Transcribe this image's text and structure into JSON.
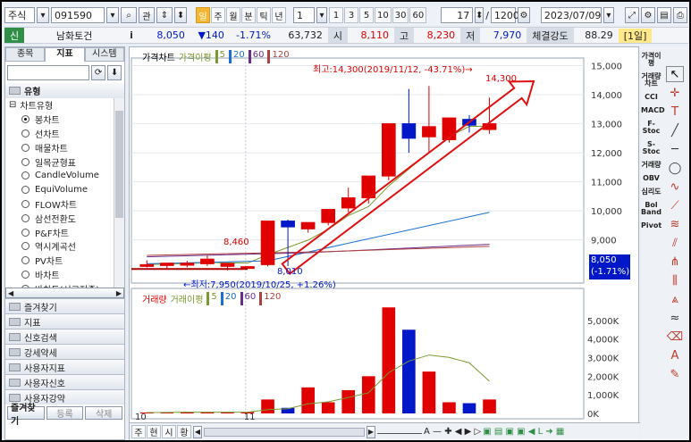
{
  "toolbar": {
    "market": "주식",
    "code": "091590",
    "btn_search": "⌕",
    "btn_gwan": "관",
    "periods": [
      "일",
      "주",
      "월",
      "분",
      "틱",
      "년"
    ],
    "active_period": "일",
    "interval_select": "1",
    "quick_intervals": [
      "1",
      "3",
      "5",
      "10",
      "30",
      "60"
    ],
    "count1": "17",
    "count2": "1200",
    "date": "2023/07/09"
  },
  "quote": {
    "badge": "신",
    "name": "남화토건",
    "info": "i",
    "price": "8,050",
    "change": "▼140",
    "pct": "-1.71%",
    "volume": "63,732",
    "open_lbl": "시",
    "open": "8,110",
    "high_lbl": "고",
    "high": "8,230",
    "low_lbl": "저",
    "low": "7,970",
    "strength_lbl": "체결강도",
    "strength": "88.29",
    "period_badge": "[1일]"
  },
  "left": {
    "tabs": [
      "종목",
      "지표",
      "시스템"
    ],
    "active_tab": "지표",
    "group_title": "유형",
    "subgroup": "차트유형",
    "items": [
      "봉차트",
      "선차트",
      "매물차트",
      "일목균형표",
      "CandleVolume",
      "EquiVolume",
      "FLOW차트",
      "삼선전환도",
      "P&F차트",
      "역시계곡선",
      "PV차트",
      "바차트",
      "바차트(시고저종)"
    ],
    "selected": "봉차트",
    "folders": [
      "즐겨찾기",
      "지표",
      "신호검색",
      "강세약세",
      "사용자지표",
      "사용자신호",
      "사용자강약"
    ],
    "bottom_tabs": [
      "즐겨찾기",
      "등록",
      "삭제"
    ]
  },
  "price_panel": {
    "legend": [
      "가격차트",
      "가격이평",
      "5",
      "20",
      "60",
      "120"
    ],
    "high_note": "최고:14,300(2019/11/12, -43.71%)→",
    "low_note": "←최저:7,950(2019/10/25, +1.26%)",
    "label_high": "14,300",
    "label_8460": "8,460",
    "label_8010": "8,010",
    "cur_price": "8,050",
    "cur_pct": "(-1.71%)"
  },
  "volume_panel": {
    "legend": [
      "거래량",
      "거래이평",
      "5",
      "20",
      "60",
      "120"
    ]
  },
  "x_axis": {
    "labels": [
      "10",
      "11"
    ]
  },
  "bottom": {
    "tabs": [
      "주",
      "현",
      "시",
      "황"
    ]
  },
  "colors": {
    "up": "#e00000",
    "down": "#0018c8",
    "ma5": "#7a9a2e",
    "ma20": "#1a6fd0",
    "ma60": "#6a2c8a",
    "ma120": "#b04040",
    "arrow": "#e01010"
  },
  "right_panel": {
    "indicators": [
      "가격이평",
      "거래량차트",
      "CCI",
      "MACD",
      "F-Stoc",
      "S-Stoc",
      "거래량",
      "OBV",
      "심리도",
      "Bol Band",
      "Pivot"
    ]
  },
  "chart_data": {
    "type": "candlestick",
    "x": [
      "2019-10-21",
      "2019-10-22",
      "2019-10-23",
      "2019-10-24",
      "2019-10-25",
      "2019-10-28",
      "2019-10-29",
      "2019-10-30",
      "2019-10-31",
      "2019-11-01",
      "2019-11-04",
      "2019-11-05",
      "2019-11-06",
      "2019-11-07",
      "2019-11-08",
      "2019-11-11",
      "2019-11-12",
      "2019-11-13"
    ],
    "open": [
      8130,
      8120,
      8130,
      8180,
      8090,
      8050,
      8150,
      9650,
      9380,
      9600,
      10100,
      10450,
      11200,
      13000,
      12550,
      12450,
      13150,
      12800
    ],
    "high": [
      8300,
      8210,
      8280,
      8460,
      8200,
      8100,
      8280,
      9700,
      9520,
      9900,
      10800,
      11200,
      12300,
      14200,
      14300,
      13000,
      13300,
      13900
    ],
    "low": [
      8050,
      8030,
      8060,
      8100,
      7950,
      8010,
      8090,
      8100,
      9250,
      9500,
      9950,
      10250,
      11050,
      12000,
      12000,
      12350,
      12700,
      12650
    ],
    "close": [
      8150,
      8200,
      8200,
      8340,
      8190,
      8080,
      9650,
      9450,
      9600,
      10050,
      10450,
      11200,
      13000,
      12500,
      12900,
      13200,
      12950,
      13000
    ],
    "volume": [
      50000,
      60000,
      80000,
      70000,
      60000,
      70000,
      750000,
      300000,
      1400000,
      600000,
      1250000,
      2000000,
      5700000,
      4500000,
      2250000,
      600000,
      550000,
      750000
    ],
    "ylim": [
      7700,
      15200
    ],
    "vol_ylim": [
      0,
      6000000
    ],
    "y_ticks": [
      "15,000",
      "14,000",
      "13,000",
      "12,000",
      "11,000",
      "10,000",
      "9,000"
    ],
    "vol_ticks": [
      "5,000K",
      "4,000K",
      "3,000K",
      "2,000K",
      "1,000K",
      "0K"
    ]
  }
}
